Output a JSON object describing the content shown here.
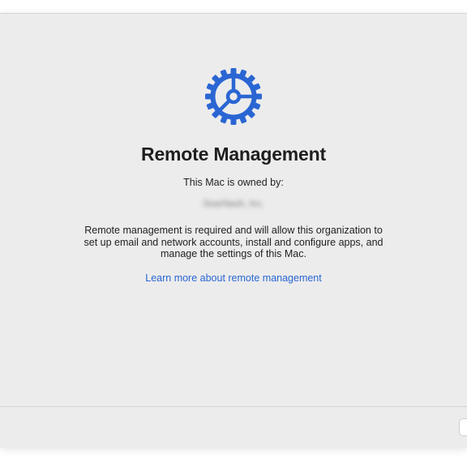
{
  "title": "Remote Management",
  "owned_by_label": "This Mac is owned by:",
  "organization_name": "SearNash, Inc.",
  "description": "Remote management is required and will allow this organization to set up email and network accounts, install and configure apps, and manage the settings of this Mac.",
  "learn_more_link": "Learn more about remote management",
  "icon": "gear-icon",
  "colors": {
    "accent": "#2a66d3",
    "background": "#ececec",
    "text": "#1e1e1e"
  }
}
